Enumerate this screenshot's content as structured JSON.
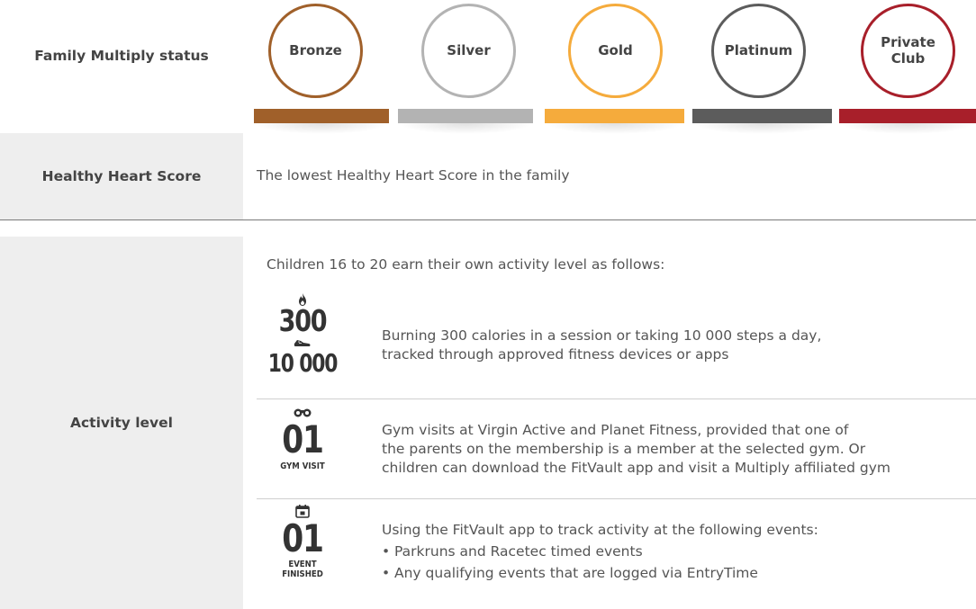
{
  "status": {
    "label": "Family Multiply status",
    "tiers": [
      {
        "name": "Bronze",
        "color": "#a0602a"
      },
      {
        "name": "Silver",
        "color": "#b3b3b3"
      },
      {
        "name": "Gold",
        "color": "#f5ab3c"
      },
      {
        "name": "Platinum",
        "color": "#5c5c5c"
      },
      {
        "name": "Private\nClub",
        "color": "#a81f2a"
      }
    ]
  },
  "heart": {
    "label": "Healthy Heart Score",
    "text": "The lowest Healthy Heart Score in the family"
  },
  "activity": {
    "label": "Activity level",
    "intro": "Children 16 to 20 earn their own activity level as follows:",
    "items": [
      {
        "metric_top": "300",
        "metric_bottom": "10 000",
        "icon_top": "flame-icon",
        "icon_bottom": "shoe-icon",
        "lines": [
          "Burning 300 calories in a session or taking 10 000 steps a day,",
          "tracked through approved fitness devices or apps"
        ]
      },
      {
        "metric": "01",
        "caption": "GYM VISIT",
        "icon": "binoculars-icon",
        "lines": [
          "Gym visits at Virgin Active and Planet Fitness, provided that one of",
          "the parents on the membership is a member at the selected gym. Or",
          "children can download the FitVault app and visit a Multiply affiliated gym"
        ]
      },
      {
        "metric": "01",
        "caption_line1": "EVENT",
        "caption_line2": "FINISHED",
        "icon": "calendar-icon",
        "intro": "Using the FitVault app to track activity at the following events:",
        "bullets": [
          "Parkruns and Racetec timed events",
          "Any qualifying events that are logged via EntryTime"
        ]
      }
    ]
  }
}
